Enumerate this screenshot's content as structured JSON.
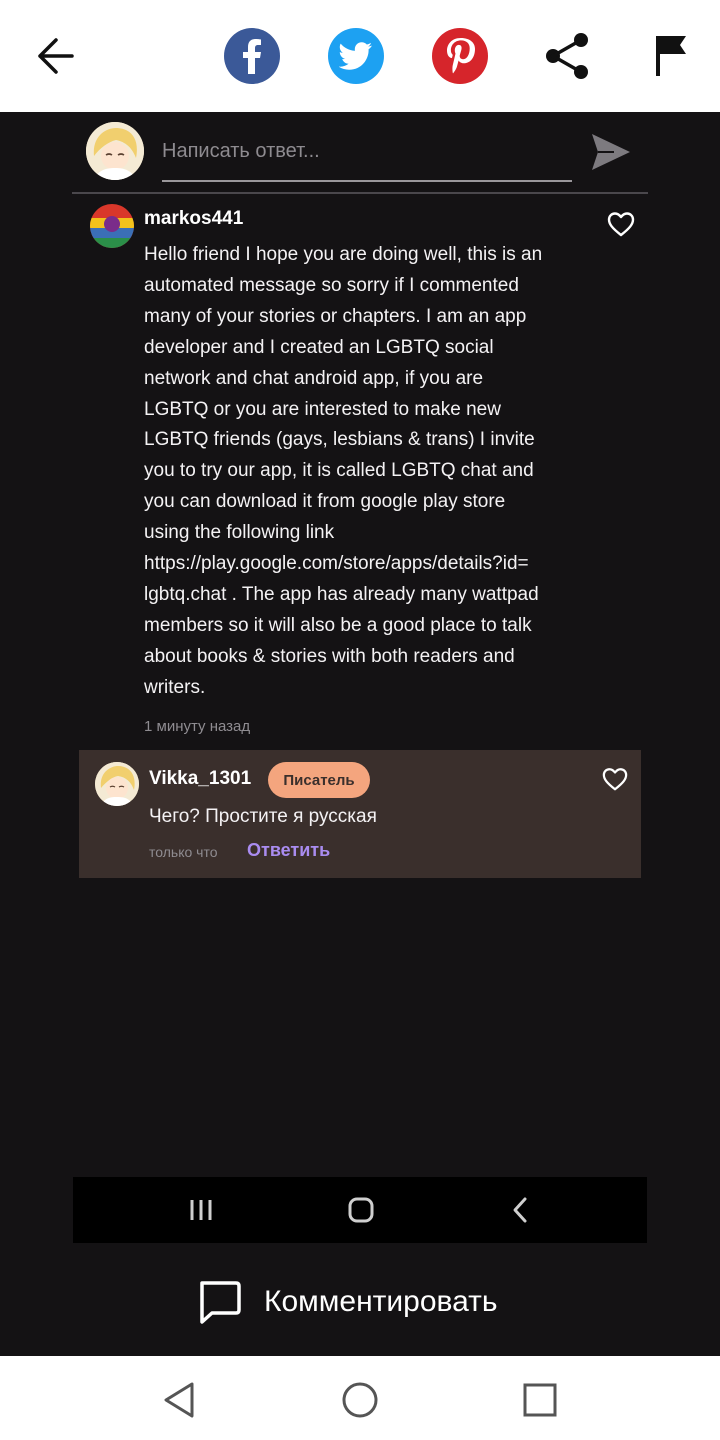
{
  "topbar": {
    "back_icon": "arrow-left-icon",
    "share_buttons": [
      {
        "name": "facebook",
        "icon": "facebook-icon",
        "color": "#3b5998"
      },
      {
        "name": "twitter",
        "icon": "twitter-icon",
        "color": "#1da1f2"
      },
      {
        "name": "pinterest",
        "icon": "pinterest-icon",
        "color": "#d6252b"
      },
      {
        "name": "share",
        "icon": "share-icon"
      },
      {
        "name": "report",
        "icon": "flag-icon"
      }
    ]
  },
  "reply_box": {
    "placeholder": "Написать ответ..."
  },
  "comment": {
    "username": "markos441",
    "text": "Hello friend I hope you are doing well, this is an\nautomated message so sorry if I commented\nmany of your stories or chapters. I am an app\ndeveloper and I created an LGBTQ social\nnetwork and chat android app, if you are\nLGBTQ or you are interested to make new\nLGBTQ friends (gays, lesbians & trans) I invite\nyou to try our app, it is called LGBTQ chat and\nyou can download it from google play store\nusing the following link\nhttps://play.google.com/store/apps/details?id=\nlgbtq.chat . The app has already many wattpad\nmembers so it will also be a good place to talk\nabout books & stories with both readers and\nwriters.",
    "time": "1 минуту назад"
  },
  "reply": {
    "username": "Vikka_1301",
    "badge": "Писатель",
    "text": "Чего? Простите я русская",
    "time": "только что",
    "answer_label": "Ответить"
  },
  "comment_button": {
    "label": "Комментировать"
  },
  "colors": {
    "background": "#141214",
    "reply_card": "#3a2f2c",
    "badge": "#f4a57e",
    "link_accent": "#a98cf0"
  }
}
